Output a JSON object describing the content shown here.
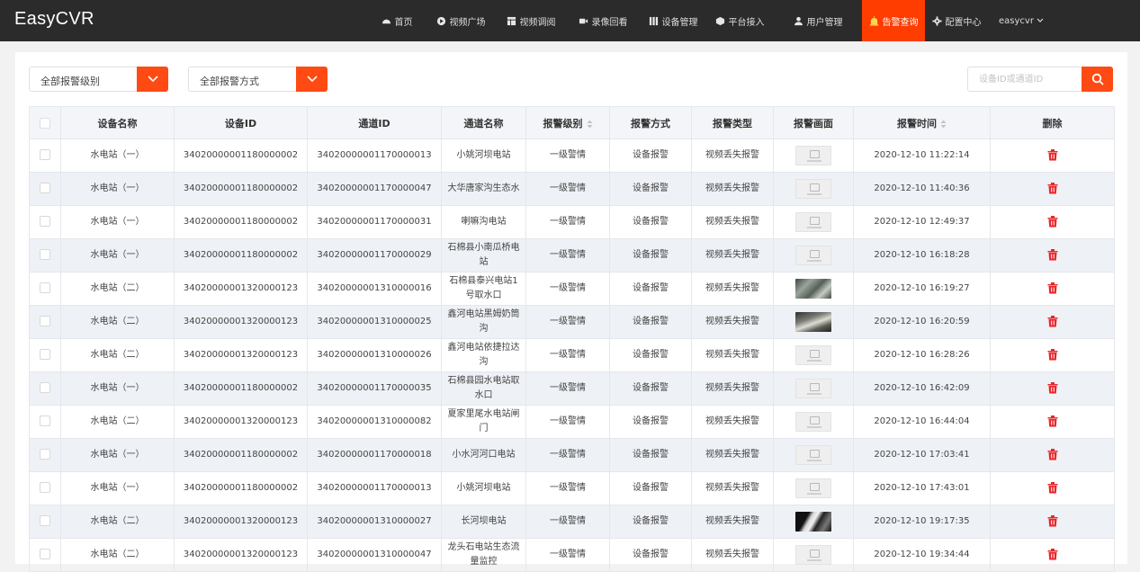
{
  "app": {
    "title": "EasyCVR"
  },
  "nav": [
    {
      "label": "首页",
      "icon": "dashboard-icon",
      "active": false
    },
    {
      "label": "视频广场",
      "icon": "play-circle-icon",
      "active": false
    },
    {
      "label": "视频调阅",
      "icon": "grid-icon",
      "active": false
    },
    {
      "label": "录像回看",
      "icon": "video-camera-icon",
      "active": false
    },
    {
      "label": "设备管理",
      "icon": "device-icon",
      "active": false
    },
    {
      "label": "平台接入",
      "icon": "cube-icon",
      "active": false
    },
    {
      "label": "用户管理",
      "icon": "user-icon",
      "active": false
    },
    {
      "label": "告警查询",
      "icon": "alarm-icon",
      "active": true
    },
    {
      "label": "配置中心",
      "icon": "gear-icon",
      "active": false
    }
  ],
  "user": {
    "name": "easycvr"
  },
  "filters": {
    "level": "全部报警级别",
    "method": "全部报警方式"
  },
  "search": {
    "placeholder": "设备ID或通道ID"
  },
  "table": {
    "headers": [
      "设备名称",
      "设备ID",
      "通道ID",
      "通道名称",
      "报警级别",
      "报警方式",
      "报警类型",
      "报警画面",
      "报警时间",
      "删除"
    ],
    "rows": [
      {
        "device_name": "水电站（一）",
        "device_id": "34020000001180000002",
        "channel_id": "34020000001170000013",
        "channel_name": "小姚河坝电站",
        "level": "一级警情",
        "method": "设备报警",
        "type": "视频丢失报警",
        "image": "placeholder",
        "time": "2020-12-10 11:22:14"
      },
      {
        "device_name": "水电站（一）",
        "device_id": "34020000001180000002",
        "channel_id": "34020000001170000047",
        "channel_name": "大华唐家沟生态水",
        "level": "一级警情",
        "method": "设备报警",
        "type": "视频丢失报警",
        "image": "placeholder",
        "time": "2020-12-10 11:40:36"
      },
      {
        "device_name": "水电站（一）",
        "device_id": "34020000001180000002",
        "channel_id": "34020000001170000031",
        "channel_name": "喇嘛沟电站",
        "level": "一级警情",
        "method": "设备报警",
        "type": "视频丢失报警",
        "image": "placeholder",
        "time": "2020-12-10 12:49:37"
      },
      {
        "device_name": "水电站（一）",
        "device_id": "34020000001180000002",
        "channel_id": "34020000001170000029",
        "channel_name": "石棉县小南瓜桥电站",
        "level": "一级警情",
        "method": "设备报警",
        "type": "视频丢失报警",
        "image": "placeholder",
        "time": "2020-12-10 16:18:28"
      },
      {
        "device_name": "水电站（二）",
        "device_id": "34020000001320000123",
        "channel_id": "34020000001310000016",
        "channel_name": "石棉县泰兴电站1号取水口",
        "level": "一级警情",
        "method": "设备报警",
        "type": "视频丢失报警",
        "image": "photo-1",
        "time": "2020-12-10 16:19:27"
      },
      {
        "device_name": "水电站（二）",
        "device_id": "34020000001320000123",
        "channel_id": "34020000001310000025",
        "channel_name": "鑫河电站黑姆奶筒沟",
        "level": "一级警情",
        "method": "设备报警",
        "type": "视频丢失报警",
        "image": "photo-2",
        "time": "2020-12-10 16:20:59"
      },
      {
        "device_name": "水电站（二）",
        "device_id": "34020000001320000123",
        "channel_id": "34020000001310000026",
        "channel_name": "鑫河电站依捷拉达沟",
        "level": "一级警情",
        "method": "设备报警",
        "type": "视频丢失报警",
        "image": "placeholder",
        "time": "2020-12-10 16:28:26"
      },
      {
        "device_name": "水电站（一）",
        "device_id": "34020000001180000002",
        "channel_id": "34020000001170000035",
        "channel_name": "石棉县园水电站取水口",
        "level": "一级警情",
        "method": "设备报警",
        "type": "视频丢失报警",
        "image": "placeholder",
        "time": "2020-12-10 16:42:09"
      },
      {
        "device_name": "水电站（二）",
        "device_id": "34020000001320000123",
        "channel_id": "34020000001310000082",
        "channel_name": "夏家里尾水电站闸门",
        "level": "一级警情",
        "method": "设备报警",
        "type": "视频丢失报警",
        "image": "placeholder",
        "time": "2020-12-10 16:44:04"
      },
      {
        "device_name": "水电站（一）",
        "device_id": "34020000001180000002",
        "channel_id": "34020000001170000018",
        "channel_name": "小水河河口电站",
        "level": "一级警情",
        "method": "设备报警",
        "type": "视频丢失报警",
        "image": "placeholder",
        "time": "2020-12-10 17:03:41"
      },
      {
        "device_name": "水电站（一）",
        "device_id": "34020000001180000002",
        "channel_id": "34020000001170000013",
        "channel_name": "小姚河坝电站",
        "level": "一级警情",
        "method": "设备报警",
        "type": "视频丢失报警",
        "image": "placeholder",
        "time": "2020-12-10 17:43:01"
      },
      {
        "device_name": "水电站（二）",
        "device_id": "34020000001320000123",
        "channel_id": "34020000001310000027",
        "channel_name": "长河坝电站",
        "level": "一级警情",
        "method": "设备报警",
        "type": "视频丢失报警",
        "image": "photo-3",
        "time": "2020-12-10 19:17:35"
      },
      {
        "device_name": "水电站（二）",
        "device_id": "34020000001320000123",
        "channel_id": "34020000001310000047",
        "channel_name": "龙头石电站生态流量监控",
        "level": "一级警情",
        "method": "设备报警",
        "type": "视频丢失报警",
        "image": "placeholder",
        "time": "2020-12-10 19:34:44"
      }
    ]
  },
  "colors": {
    "accent": "#ff4a14",
    "topbar": "#2b2b2b",
    "delete": "#e8262a"
  }
}
